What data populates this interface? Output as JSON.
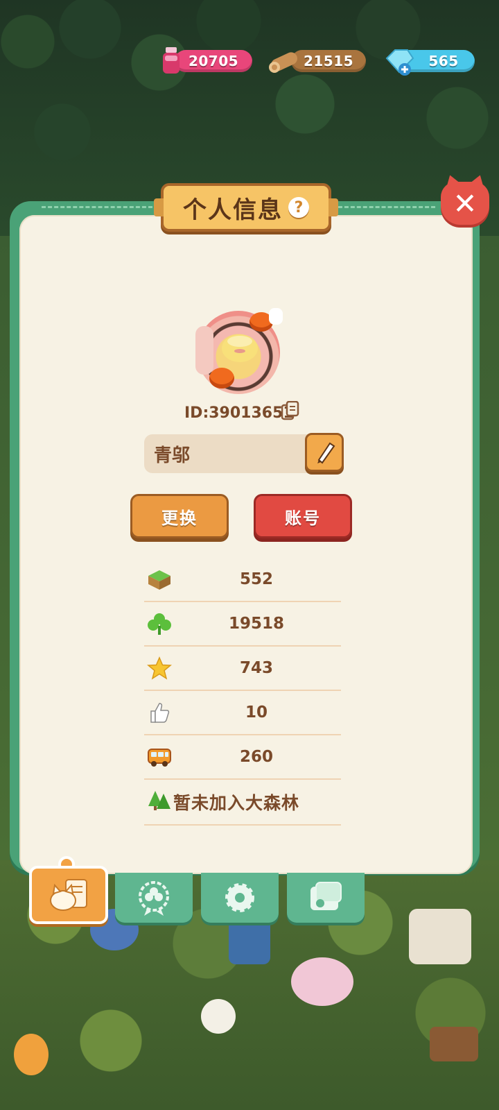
{
  "resources": {
    "potion": {
      "value": "20705",
      "icon": "potion-bottle-icon",
      "color": "#e8467a"
    },
    "wood": {
      "value": "21515",
      "icon": "wood-log-icon",
      "color": "#a9743e"
    },
    "gem": {
      "value": "565",
      "icon": "gem-plus-icon",
      "color": "#49c7ea"
    }
  },
  "dialog": {
    "title": "个人信息",
    "help": "?",
    "close": "✕"
  },
  "profile": {
    "id_label": "ID:39013651",
    "name": "青邬",
    "buttons": {
      "change": "更换",
      "account": "账号"
    }
  },
  "stats": [
    {
      "icon": "grass-block-icon",
      "value": "552"
    },
    {
      "icon": "clover-icon",
      "value": "19518"
    },
    {
      "icon": "star-icon",
      "value": "743"
    },
    {
      "icon": "thumbs-up-icon",
      "value": "10"
    },
    {
      "icon": "bus-icon",
      "value": "260"
    }
  ],
  "forest_status": "暂未加入大森林",
  "tabs": [
    {
      "name": "profile-tab",
      "icon": "cat-card-icon",
      "active": true
    },
    {
      "name": "badge-tab",
      "icon": "clover-badge-icon",
      "active": false
    },
    {
      "name": "settings-tab",
      "icon": "gear-icon",
      "active": false
    },
    {
      "name": "album-tab",
      "icon": "photo-album-icon",
      "active": false
    }
  ],
  "colors": {
    "panel_green": "#4aa277",
    "panel_cream": "#f7f2e4",
    "text_brown": "#7a4a2a",
    "button_orange": "#eb9a42",
    "button_red": "#e14a42"
  }
}
